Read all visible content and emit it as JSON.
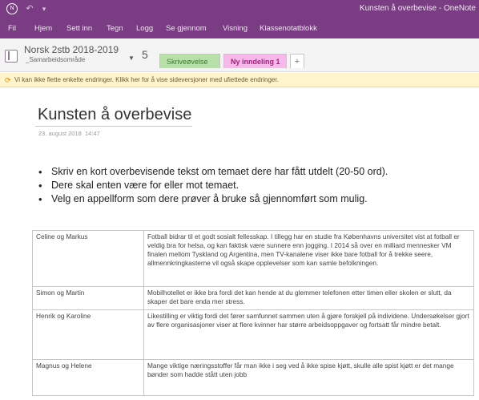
{
  "window": {
    "title": "Kunsten å overbevise  -  OneNote",
    "icons": [
      "onenote-logo-icon",
      "undo-icon",
      "pin-icon"
    ]
  },
  "ribbon": {
    "tabs": [
      "Fil",
      "Hjem",
      "Sett inn",
      "Tegn",
      "Logg",
      "Se gjennom",
      "Visning",
      "Klassenotatblokk"
    ]
  },
  "notebook": {
    "name": "Norsk 2stb 2018-2019",
    "section_group": "_Samarbeidsområde",
    "number": "5",
    "sections": [
      {
        "label": "Skriveøvelse",
        "color": "#b7e1a9"
      },
      {
        "label": "Ny inndeling 1",
        "color": "#f7b9e9"
      }
    ],
    "add_label": "+"
  },
  "infobar": {
    "text": "Vi kan ikke flette enkelte endringer. Klikk her for å vise sideversjoner med ufiettede endringer."
  },
  "page": {
    "title": "Kunsten å overbevise",
    "date": "23. august 2018",
    "time": "14:47",
    "bullets": [
      "Skriv en kort overbevisende tekst om temaet dere har fått utdelt (20-50 ord).",
      "Dere skal enten være for eller mot temaet.",
      "Velg en appellform som dere prøver å bruke så gjennomført som mulig."
    ]
  },
  "table": {
    "rows": [
      {
        "names": "Celine og Markus",
        "text": "Fotball bidrar til et godt sosialt fellesskap. I tillegg har en studie fra Københavns universitet vist at fotball er veldig bra for helsa, og kan faktisk være sunnere enn jogging. I 2014 så over en milliard mennesker VM finalen mellom Tyskland og Argentina, men TV-kanalene viser ikke bare fotball for å trekke seere, allmennkringkasterne vil også skape opplevelser som kan samle befolkningen."
      },
      {
        "names": "Simon og Martin",
        "text": "Mobilhotellet er ikke bra fordi det kan hende at du glemmer telefonen etter timen eller skolen er slutt, da skaper det bare enda mer stress."
      },
      {
        "names": "Henrik og Karoline",
        "text": "Likestilling er viktig fordi det fører samfunnet sammen uten å gjøre forskjell på individene. Undersøkelser gjort av flere organisasjoner viser at flere kvinner har større arbeidsoppgaver og fortsatt får mindre betalt."
      },
      {
        "names": "Magnus og Helene",
        "text": "Mange viktige næringsstoffer får man ikke i seg ved å ikke spise kjøtt, skulle alle spist kjøtt er det mange bønder som hadde stått uten jobb"
      }
    ]
  }
}
